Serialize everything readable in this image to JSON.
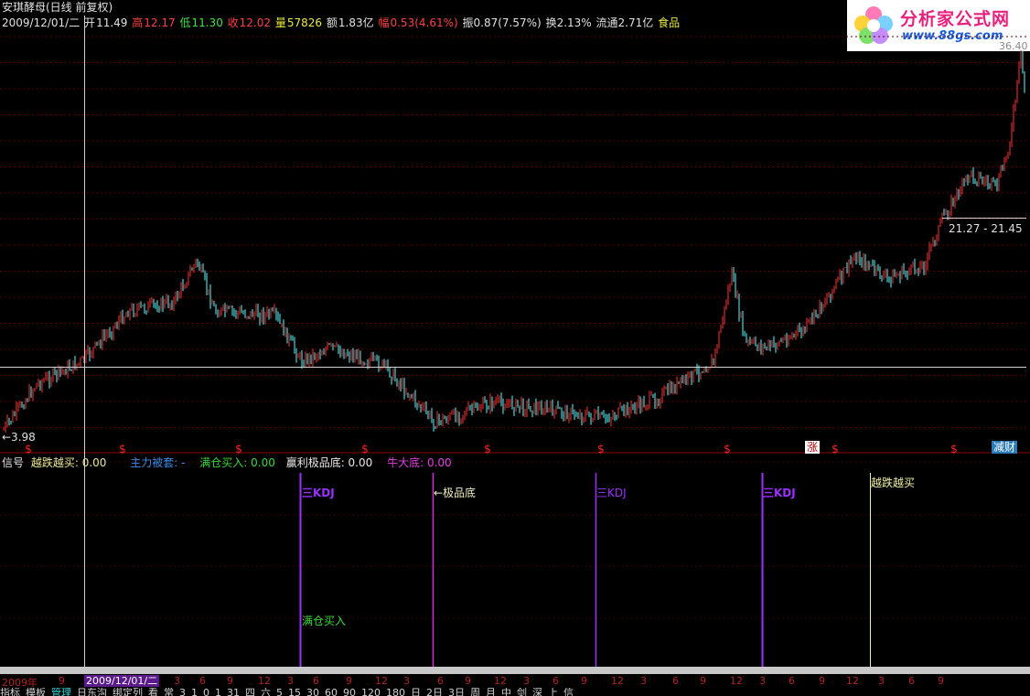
{
  "quote": {
    "name_period": "安琪酵母(日线 前复权)",
    "date": "2009/12/01/二",
    "open_label": "开",
    "open_value": "11.49",
    "high_label": "高",
    "high_value": "12.17",
    "low_label": "低",
    "low_value": "11.30",
    "close_label": "收",
    "close_value": "12.02",
    "volume_label": "量",
    "volume_value": "57826",
    "amount_label": "额",
    "amount_value": "1.83亿",
    "change_label": "幅",
    "change_value": "0.53(4.61%)",
    "amplitude": "振0.87(7.57%)",
    "turnover": "换2.13%",
    "float_cap": "流通2.71亿",
    "sector": "食品"
  },
  "logo": {
    "name": "分析家公式网",
    "url": "www.88gs.com"
  },
  "chart": {
    "low_marker": "←3.98",
    "range_label": "21.27 - 21.45",
    "top_price": "36.40",
    "signal_char": "$",
    "badge_up": "涨",
    "badge_reduce": "减财"
  },
  "indicator": {
    "name": "信号",
    "items": [
      {
        "label": "越跌越买: 0.00",
        "color": "#e8e890"
      },
      {
        "label": "主力被套: -",
        "color": "#3a8ce8"
      },
      {
        "label": "满仓买入: 0.00",
        "color": "#38d838"
      },
      {
        "label": "赢利极品底: 0.00",
        "color": "#e8e8e8"
      },
      {
        "label": "牛大底: 0.00",
        "color": "#e040e0"
      }
    ]
  },
  "signals": {
    "kdj1": "三KDJ",
    "jipin": "←极品底",
    "kdj2": "三KDJ",
    "kdj3": "三KDJ",
    "yuedie": "越跌越买",
    "mancang": "满仓买入"
  },
  "date_axis": {
    "year": "2009年",
    "cursor": "2009/12/01/二",
    "ticks": [
      "9",
      "12",
      "3",
      "6",
      "9",
      "12",
      "3",
      "6",
      "9",
      "12",
      "3",
      "6",
      "9",
      "12",
      "3",
      "6",
      "9",
      "12",
      "3",
      "6",
      "9",
      "12",
      "3",
      "6",
      "9",
      "12",
      "3",
      "6",
      "9"
    ]
  },
  "bottom_tabs": [
    "指标",
    "模板",
    "管理",
    "日东沟",
    "绑定列",
    "看",
    "常",
    "3",
    "1",
    "0",
    "1",
    "31",
    "四",
    "六",
    "5",
    "15",
    "30",
    "60",
    "90",
    "120",
    "180",
    "日",
    "2日",
    "3日",
    "周",
    "月",
    "中",
    "剑",
    "深",
    "上",
    "信"
  ],
  "colors": {
    "up": "#ff3232",
    "down": "#54ffff",
    "ma": "#ffffff",
    "purple": "#9b30ff"
  }
}
